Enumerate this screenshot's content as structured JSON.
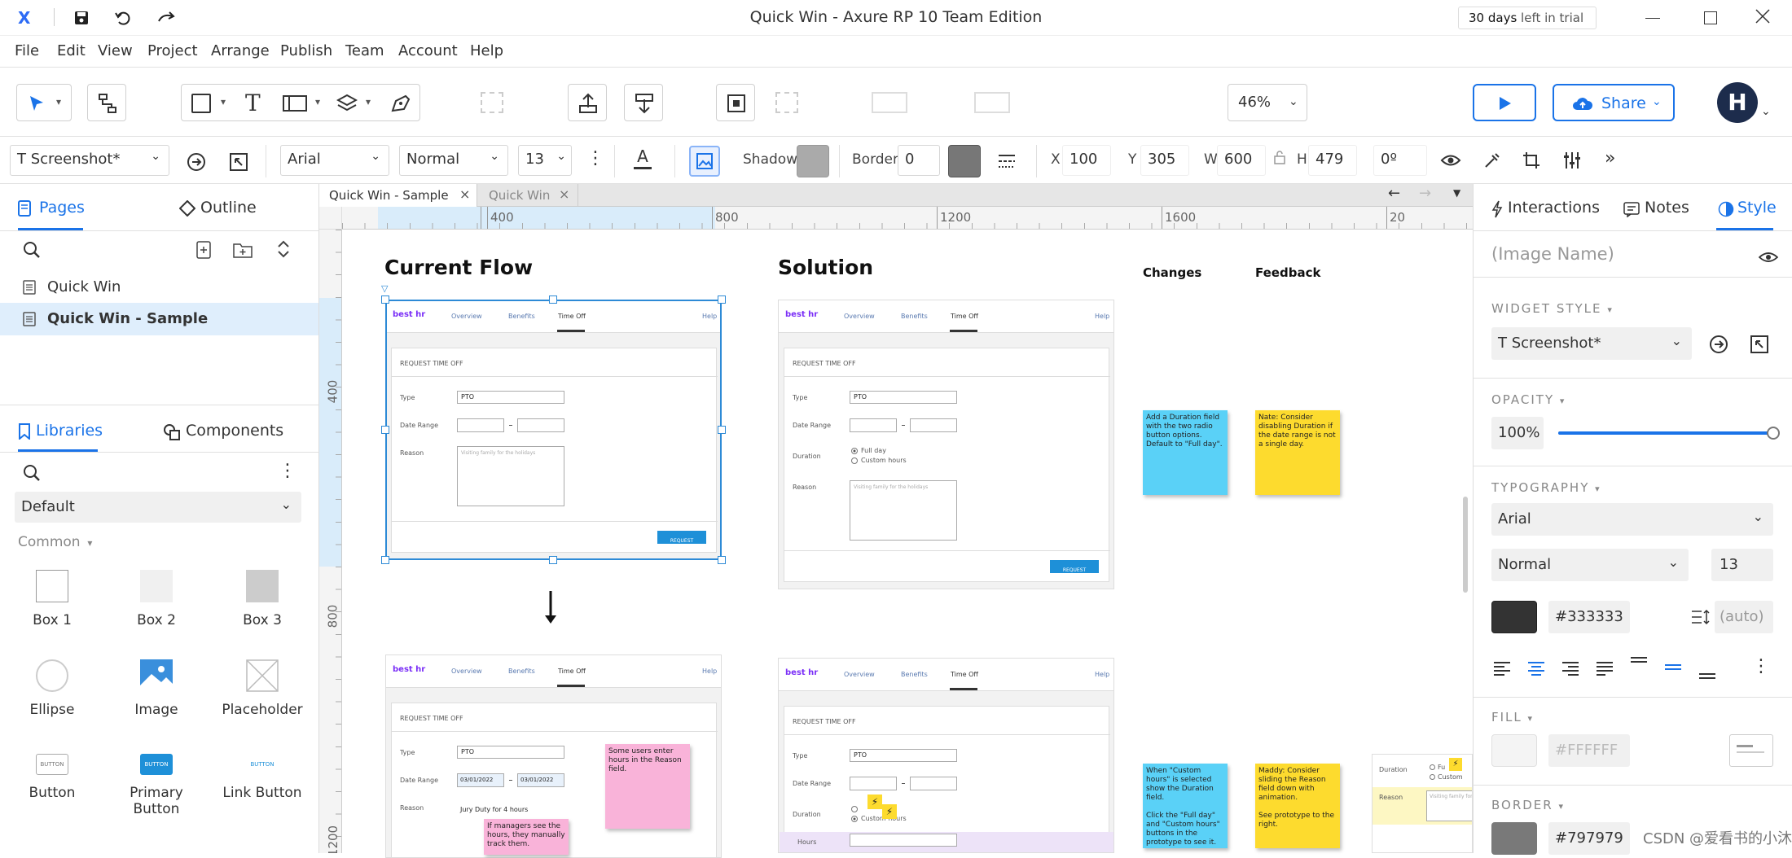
{
  "window": {
    "title": "Quick Win - Axure RP 10 Team Edition",
    "trial_days": "30 days",
    "trial_text": "left in trial"
  },
  "menu": [
    "File",
    "Edit",
    "View",
    "Project",
    "Arrange",
    "Publish",
    "Team",
    "Account",
    "Help"
  ],
  "toolbar": {
    "zoom": "46%",
    "share_label": "Share",
    "avatar_initial": "H"
  },
  "propbar": {
    "widget_name": "T Screenshot*",
    "font_family": "Arial",
    "font_style": "Normal",
    "font_size": "13",
    "shadow_label": "Shadow",
    "border_label": "Border",
    "border_value": "0",
    "x_label": "X",
    "x_value": "100",
    "y_label": "Y",
    "y_value": "305",
    "w_label": "W",
    "w_value": "600",
    "h_label": "H",
    "h_value": "479",
    "rotation": "0º"
  },
  "left_panel": {
    "tab_pages": "Pages",
    "tab_outline": "Outline",
    "pages": [
      "Quick Win",
      "Quick Win - Sample"
    ],
    "tab_libraries": "Libraries",
    "tab_components": "Components",
    "library_select": "Default",
    "section": "Common",
    "items": [
      "Box 1",
      "Box 2",
      "Box 3",
      "Ellipse",
      "Image",
      "Placeholder",
      "Button",
      "Primary Button",
      "Link Button"
    ]
  },
  "doc_tabs": [
    "Quick Win - Sample",
    "Quick Win"
  ],
  "ruler": {
    "h_ticks": [
      "400",
      "800",
      "1200",
      "1600",
      "20"
    ],
    "v_ticks": [
      "400",
      "800",
      "1200"
    ]
  },
  "canvas": {
    "current_flow": "Current Flow",
    "solution": "Solution",
    "changes": "Changes",
    "feedback": "Feedback",
    "logo": "best hr",
    "nav": [
      "Overview",
      "Benefits",
      "Time Off",
      "Help"
    ],
    "card_title": "REQUEST TIME OFF",
    "type_label": "Type",
    "type_value": "PTO",
    "date_label": "Date Range",
    "reason_label": "Reason",
    "reason_placeholder": "Visiting family for the holidays",
    "request_btn": "REQUEST",
    "duration_label": "Duration",
    "full_day": "Full day",
    "custom_hours": "Custom hours",
    "hours_label": "Hours",
    "date_start": "03/01/2022",
    "date_end": "03/01/2022",
    "jury_duty": "Jury Duty for 4 hours",
    "sticky_changes_1": "Add a Duration field with the two radio button options. Default to \"Full day\".",
    "sticky_feedback_1": "Nate: Consider disabling Duration if the date range is not a single day.",
    "sticky_users": "Some users enter hours in the Reason field.",
    "sticky_managers": "If managers see the hours, they manually track them.",
    "sticky_changes_2": "When \"Custom hours\" is selected show the Duration field.\n\nClick the \"Full day\" and \"Custom hours\" buttons in the prototype to see it.",
    "sticky_feedback_2": "Maddy: Consider sliding the Reason field down with animation.\n\nSee prototype to the right.",
    "partial_full": "Fu",
    "partial_custom": "Custom"
  },
  "right_panel": {
    "tab_interactions": "Interactions",
    "tab_notes": "Notes",
    "tab_style": "Style",
    "image_name_placeholder": "(Image Name)",
    "widget_style_hdr": "WIDGET STYLE",
    "widget_style": "T Screenshot*",
    "opacity_hdr": "OPACITY",
    "opacity": "100%",
    "opacity_fraction": 1.0,
    "typography_hdr": "TYPOGRAPHY",
    "font": "Arial",
    "font_style": "Normal",
    "font_size": "13",
    "color_hex": "#333333",
    "line_height": "(auto)",
    "fill_hdr": "FILL",
    "fill_hex": "#FFFFFF",
    "border_hdr": "BORDER",
    "border_hex": "#797979",
    "watermark": "CSDN @爱看书的小沐"
  },
  "colors": {
    "accent": "#1a73e8",
    "selection": "#2d8ad6",
    "sticky_blue": "#5ad1f7",
    "sticky_yellow": "#fddb2e",
    "sticky_pink": "#f9b3d9",
    "brand_purple": "#7b2ff7",
    "text_color": "#333333",
    "border_color": "#797979"
  }
}
